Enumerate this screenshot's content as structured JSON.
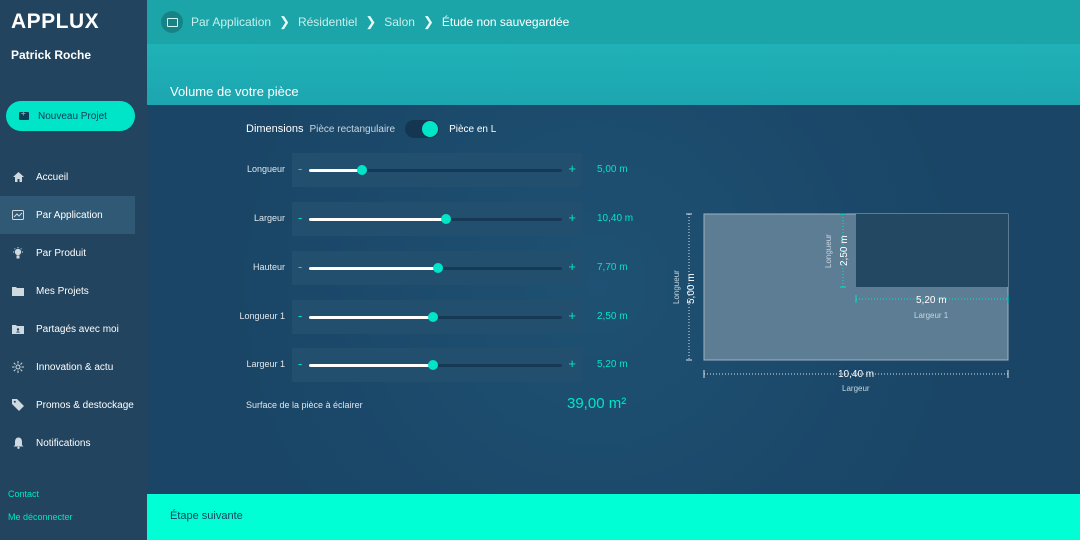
{
  "app": {
    "title": "APPLUX",
    "user": "Patrick Roche"
  },
  "sidebar": {
    "new_project": "Nouveau Projet",
    "items": [
      {
        "label": "Accueil",
        "icon": "home-icon"
      },
      {
        "label": "Par Application",
        "icon": "application-icon",
        "active": true
      },
      {
        "label": "Par Produit",
        "icon": "lamp-icon"
      },
      {
        "label": "Mes Projets",
        "icon": "folder-icon"
      },
      {
        "label": "Partagés avec moi",
        "icon": "shared-folder-icon"
      },
      {
        "label": "Innovation & actu",
        "icon": "innovation-icon"
      },
      {
        "label": "Promos & destockage",
        "icon": "tag-icon"
      },
      {
        "label": "Notifications",
        "icon": "bell-icon"
      }
    ],
    "contact": "Contact",
    "logout": "Me déconnecter"
  },
  "breadcrumb": [
    "Par Application",
    "Résidentiel",
    "Salon",
    "Étude non sauvegardée"
  ],
  "page": {
    "title": "Volume de votre pièce"
  },
  "dimensions": {
    "title": "Dimensions",
    "option_rect": "Pièce rectangulaire",
    "option_l": "Pièce en L",
    "l_selected": true
  },
  "sliders": [
    {
      "label": "Longueur",
      "value": "5,00  m",
      "fraction": 0.21
    },
    {
      "label": "Largeur",
      "value": "10,40  m",
      "fraction": 0.54
    },
    {
      "label": "Hauteur",
      "value": "7,70  m",
      "fraction": 0.51
    },
    {
      "label": "Longueur 1",
      "value": "2,50  m",
      "fraction": 0.49
    },
    {
      "label": "Largeur 1",
      "value": "5,20  m",
      "fraction": 0.49
    }
  ],
  "slider_controls": {
    "minus": "-",
    "plus": "+"
  },
  "surface": {
    "label": "Surface de la pièce à éclairer",
    "value": "39,00 m²"
  },
  "diagram": {
    "main_length_value": "5,00 m",
    "main_length_label": "Longueur",
    "main_width_value": "10,40 m",
    "main_width_label": "Largeur",
    "cut_length_value": "2,50 m",
    "cut_length_label": "Longueur",
    "cut_width_value": "5,20 m",
    "cut_width_label": "Largeur 1"
  },
  "footer": {
    "next_step": "Étape suivante"
  },
  "colors": {
    "accent": "#00e5c8",
    "sidebar": "#22445e",
    "topbar": "#1ca5a8",
    "main": "#1b4a6b"
  }
}
